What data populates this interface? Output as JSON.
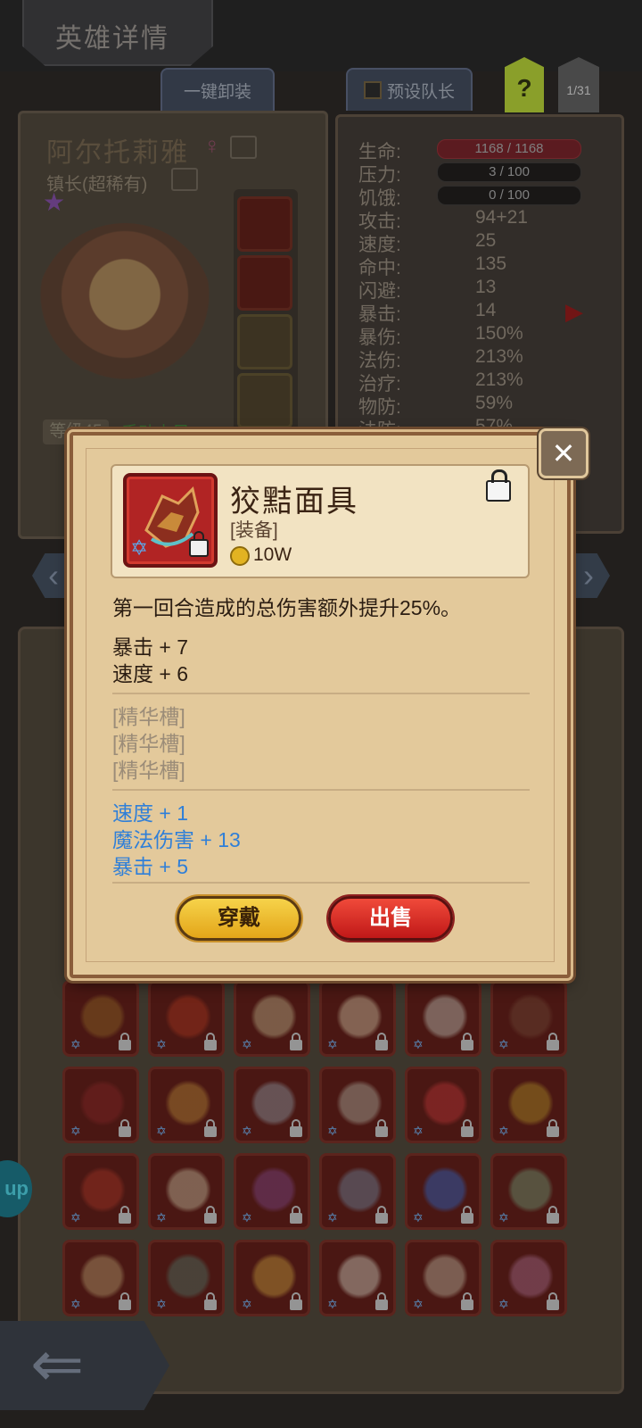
{
  "header": {
    "title": "英雄详情"
  },
  "toolbar": {
    "unequip_all": "一键卸装",
    "preset_leader": "预设队长",
    "help": "?",
    "page": "1/31"
  },
  "hero": {
    "name": "阿尔托莉雅",
    "role": "镇长(超稀有)",
    "level": "等级45",
    "level_badge_partial": "手动十尺"
  },
  "stats": [
    {
      "label": "生命:",
      "value": "1168 / 1168",
      "kind": "hp-bar"
    },
    {
      "label": "压力:",
      "value": "3 / 100",
      "kind": "dark-bar"
    },
    {
      "label": "饥饿:",
      "value": "0 / 100",
      "kind": "dark-bar"
    },
    {
      "label": "攻击:",
      "value": "94+21"
    },
    {
      "label": "速度:",
      "value": "25"
    },
    {
      "label": "命中:",
      "value": "135"
    },
    {
      "label": "闪避:",
      "value": "13"
    },
    {
      "label": "暴击:",
      "value": "14"
    },
    {
      "label": "暴伤:",
      "value": "150%"
    },
    {
      "label": "法伤:",
      "value": "213%"
    },
    {
      "label": "治疗:",
      "value": "213%"
    },
    {
      "label": "物防:",
      "value": "59%"
    },
    {
      "label": "法防:",
      "value": "57%"
    }
  ],
  "item": {
    "name": "狡黠面具",
    "type": "[装备]",
    "price": "10W",
    "description": "第一回合造成的总伤害额外提升25%。",
    "base_stats": [
      "暴击 + 7",
      "速度 + 6"
    ],
    "essence_slots": [
      "[精华槽]",
      "[精华槽]",
      "[精华槽]"
    ],
    "bonus_stats": [
      "速度 + 1",
      "魔法伤害 + 13",
      "暴击 + 5"
    ],
    "equip_label": "穿戴",
    "sell_label": "出售",
    "close_label": "✕"
  },
  "inventory": {
    "colors": [
      "#9b6a2a",
      "#b43a22",
      "#c8b48a",
      "#d8c2a2",
      "#c9c3b6",
      "#7a4a38",
      "#8e2a2a",
      "#c08a3a",
      "#9aa0a8",
      "#b8b0a0",
      "#c83a3a",
      "#b8922a",
      "#b03a2a",
      "#d0c0a0",
      "#8a4a8a",
      "#7a8aa0",
      "#3a6ac8",
      "#7aa07a",
      "#c0a070",
      "#5a7a6a",
      "#d0a040",
      "#d8d0c0",
      "#c8b8a0",
      "#b07090"
    ]
  },
  "nav": {
    "back_icon": "back-arrow-icon",
    "help_float": "up"
  }
}
